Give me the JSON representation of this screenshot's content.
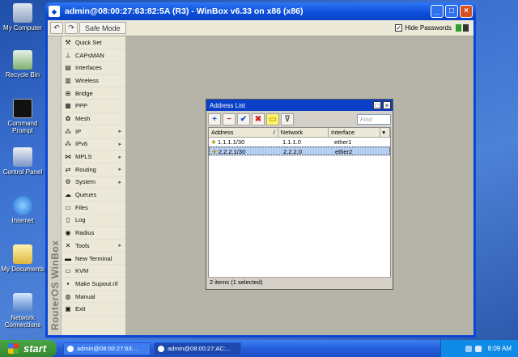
{
  "desktop": {
    "icons": [
      {
        "label": "My Computer"
      },
      {
        "label": "Recycle Bin"
      },
      {
        "label": "Command Prompt"
      },
      {
        "label": "Control Panel"
      },
      {
        "label": "Internet"
      },
      {
        "label": "My Documents"
      },
      {
        "label": "Network Connections"
      }
    ]
  },
  "window": {
    "title": "admin@08:00:27:63:82:5A (R3) - WinBox v6.33 on x86 (x86)",
    "controls": {
      "minimize": "_",
      "maximize": "□",
      "close": "×"
    }
  },
  "toolbar": {
    "undo": "↶",
    "redo": "↷",
    "safe_mode": "Safe Mode",
    "hide_passwords": "Hide Passwords",
    "hide_passwords_checked": "✓"
  },
  "sidebar": {
    "vertical_label": "RouterOS WinBox",
    "items": [
      {
        "label": "Quick Set",
        "icon": "quickset-icon",
        "glyph": "⚒",
        "arrow": ""
      },
      {
        "label": "CAPsMAN",
        "icon": "capsman-icon",
        "glyph": "⊥",
        "arrow": ""
      },
      {
        "label": "Interfaces",
        "icon": "interfaces-icon",
        "glyph": "▤",
        "arrow": ""
      },
      {
        "label": "Wireless",
        "icon": "wireless-icon",
        "glyph": "▥",
        "arrow": ""
      },
      {
        "label": "Bridge",
        "icon": "bridge-icon",
        "glyph": "⊞",
        "arrow": ""
      },
      {
        "label": "PPP",
        "icon": "ppp-icon",
        "glyph": "▦",
        "arrow": ""
      },
      {
        "label": "Mesh",
        "icon": "mesh-icon",
        "glyph": "✿",
        "arrow": ""
      },
      {
        "label": "IP",
        "icon": "ip-icon",
        "glyph": "⁂",
        "arrow": "▸"
      },
      {
        "label": "IPv6",
        "icon": "ipv6-icon",
        "glyph": "⁂",
        "arrow": "▸"
      },
      {
        "label": "MPLS",
        "icon": "mpls-icon",
        "glyph": "⋈",
        "arrow": "▸"
      },
      {
        "label": "Routing",
        "icon": "routing-icon",
        "glyph": "⇄",
        "arrow": "▸"
      },
      {
        "label": "System",
        "icon": "system-icon",
        "glyph": "⚙",
        "arrow": "▸"
      },
      {
        "label": "Queues",
        "icon": "queues-icon",
        "glyph": "☁",
        "arrow": ""
      },
      {
        "label": "Files",
        "icon": "files-icon",
        "glyph": "▭",
        "arrow": ""
      },
      {
        "label": "Log",
        "icon": "log-icon",
        "glyph": "▯",
        "arrow": ""
      },
      {
        "label": "Radius",
        "icon": "radius-icon",
        "glyph": "◉",
        "arrow": ""
      },
      {
        "label": "Tools",
        "icon": "tools-icon",
        "glyph": "✕",
        "arrow": "▸"
      },
      {
        "label": "New Terminal",
        "icon": "terminal-icon",
        "glyph": "▬",
        "arrow": ""
      },
      {
        "label": "KVM",
        "icon": "kvm-icon",
        "glyph": "▭",
        "arrow": ""
      },
      {
        "label": "Make Supout.rif",
        "icon": "supout-icon",
        "glyph": "▪",
        "arrow": ""
      },
      {
        "label": "Manual",
        "icon": "manual-icon",
        "glyph": "◍",
        "arrow": ""
      },
      {
        "label": "Exit",
        "icon": "exit-icon",
        "glyph": "▣",
        "arrow": ""
      }
    ]
  },
  "address_list": {
    "title": "Address List",
    "window_controls": {
      "restore": "□",
      "close": "×"
    },
    "tools": {
      "add": "+",
      "remove": "−",
      "enable": "✔",
      "disable": "✖",
      "comment": "▭",
      "filter": "⊽"
    },
    "find_placeholder": "Find",
    "columns": [
      "Address",
      "Network",
      "Interface"
    ],
    "sort_indicator": "/",
    "column_menu": "▾",
    "rows": [
      {
        "address": "1.1.1.1/30",
        "network": "1.1.1.0",
        "interface": "ether1",
        "selected": false
      },
      {
        "address": "2.2.2.1/30",
        "network": "2.2.2.0",
        "interface": "ether2",
        "selected": true
      }
    ],
    "status": "2 items (1 selected)"
  },
  "taskbar": {
    "start_label": "start",
    "tasks": [
      {
        "label": "admin@08:00:27:63:...",
        "active": false
      },
      {
        "label": "admin@08:00:27:AC:...",
        "active": true
      }
    ],
    "clock": "8:09 AM"
  },
  "colors": {
    "titlebar": "#0a46d6",
    "selection": "#b5cdf0",
    "start": "#35862e"
  }
}
